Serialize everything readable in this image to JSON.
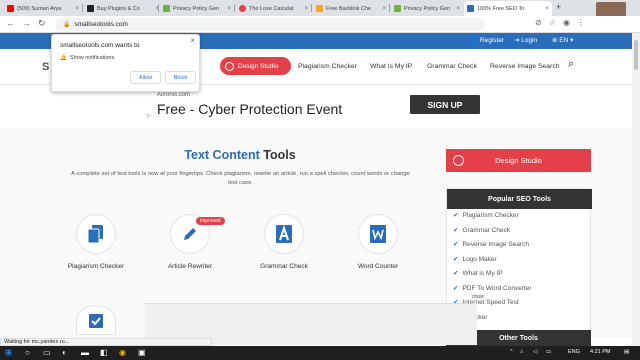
{
  "browser": {
    "tabs": [
      {
        "title": "(509) Suman Arya",
        "color": "#ff0000"
      },
      {
        "title": "Buy Plugins & Co",
        "color": "#222222"
      },
      {
        "title": "Privacy Policy Gen",
        "color": "#6cb33f"
      },
      {
        "title": "The Love Calculat",
        "color": "#e54049"
      },
      {
        "title": "Free Backlink Che",
        "color": "#f5a623"
      },
      {
        "title": "Privacy Policy Gen",
        "color": "#6cb33f"
      },
      {
        "title": "100% Free SEO To",
        "color": "#2a6ebb"
      }
    ],
    "new_tab": "+",
    "url": "smallseotools.com",
    "status_text": "Waiting for mc.yandex.ru..."
  },
  "notification": {
    "title": "smallseotools.com wants to",
    "row_text": "Show notifications",
    "allow_label": "Allow",
    "block_label": "Block",
    "close": "×"
  },
  "site": {
    "topbar": {
      "register": "Register",
      "login": "Login",
      "language": "EN"
    },
    "logo_partial": "S",
    "nav": {
      "design_studio": "Design Studio",
      "links": [
        "Plagiarism Checker",
        "What Is My IP",
        "Grammar Check",
        "Reverse Image Search"
      ]
    },
    "ad": {
      "source": "Acronis.com",
      "headline": "Free - Cyber Protection Event",
      "cta": "SIGN UP"
    },
    "main": {
      "title_colored": "Text Content",
      "title_rest": " Tools",
      "description": "A complete set of text tools is now at your fingertips. Check plagiarism, rewrite an article, run a spell checker, count words or change text case.",
      "tools": [
        {
          "label": "Plagiarism Checker",
          "icon": "document-copy-icon"
        },
        {
          "label": "Article Rewriter",
          "icon": "pencil-icon"
        },
        {
          "label": "Grammar Check",
          "icon": "letter-a-icon"
        },
        {
          "label": "Word Counter",
          "icon": "word-document-icon"
        }
      ],
      "improved_badge": "improved"
    },
    "sidebar": {
      "design_studio": "Design Studio",
      "popular_heading": "Popular SEO Tools",
      "popular_items": [
        "Plagiarism Checker",
        "Grammar Check",
        "Reverse Image Search",
        "Logo Maker",
        "What is My IP",
        "PDF To Word Converter",
        "Internet Speed Test",
        "...hecker"
      ],
      "other_heading": "Other Tools"
    },
    "close_tag": "close"
  },
  "taskbar": {
    "language": "ENG",
    "time": "4:21 PM"
  },
  "colors": {
    "brand_blue": "#2a6ebb",
    "accent_red": "#e54049"
  }
}
